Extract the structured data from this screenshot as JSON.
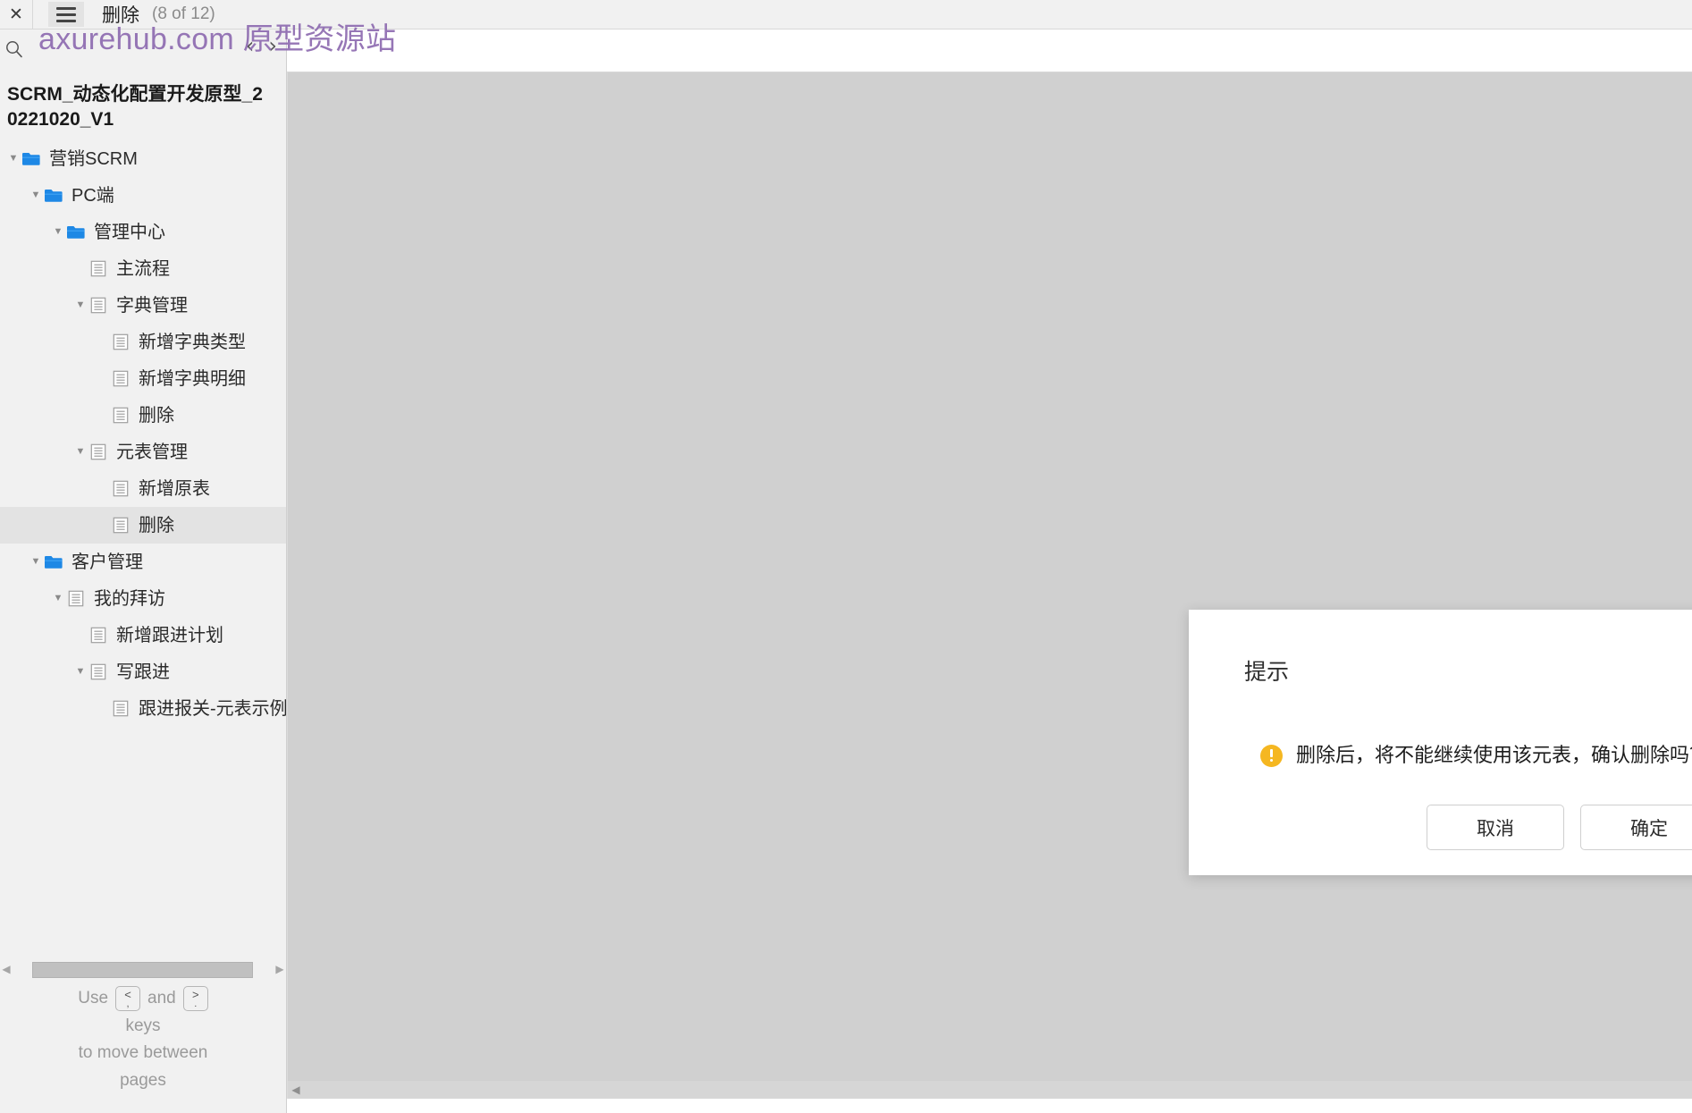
{
  "topbar": {
    "close_icon": "close-icon",
    "menu_icon": "hamburger-menu-icon",
    "page_name": "删除",
    "page_counter": "(8 of 12)"
  },
  "watermark": {
    "text": "axurehub.com 原型资源站",
    "color": "#8e6bb0"
  },
  "sidebar": {
    "search_icon": "search-icon",
    "prev_page_label": "‹",
    "next_page_label": "›",
    "project_title": "SCRM_动态化配置开发原型_20221020_V1",
    "tree": [
      {
        "label": "营销SCRM",
        "depth": 0,
        "icon": "folder-icon",
        "twisty": "▼",
        "selected": false
      },
      {
        "label": "PC端",
        "depth": 1,
        "icon": "folder-icon",
        "twisty": "▼",
        "selected": false
      },
      {
        "label": "管理中心",
        "depth": 2,
        "icon": "folder-icon",
        "twisty": "▼",
        "selected": false
      },
      {
        "label": "主流程",
        "depth": 3,
        "icon": "page-icon",
        "twisty": "",
        "selected": false
      },
      {
        "label": "字典管理",
        "depth": 3,
        "icon": "page-icon",
        "twisty": "▼",
        "selected": false
      },
      {
        "label": "新增字典类型",
        "depth": 4,
        "icon": "page-icon",
        "twisty": "",
        "selected": false
      },
      {
        "label": "新增字典明细",
        "depth": 4,
        "icon": "page-icon",
        "twisty": "",
        "selected": false
      },
      {
        "label": "删除",
        "depth": 4,
        "icon": "page-icon",
        "twisty": "",
        "selected": false
      },
      {
        "label": "元表管理",
        "depth": 3,
        "icon": "page-icon",
        "twisty": "▼",
        "selected": false
      },
      {
        "label": "新增原表",
        "depth": 4,
        "icon": "page-icon",
        "twisty": "",
        "selected": false
      },
      {
        "label": "删除",
        "depth": 4,
        "icon": "page-icon",
        "twisty": "",
        "selected": true
      },
      {
        "label": "客户管理",
        "depth": 1,
        "icon": "folder-icon",
        "twisty": "▼",
        "selected": false
      },
      {
        "label": "我的拜访",
        "depth": 2,
        "icon": "page-icon",
        "twisty": "▼",
        "selected": false
      },
      {
        "label": "新增跟进计划",
        "depth": 3,
        "icon": "page-icon",
        "twisty": "",
        "selected": false
      },
      {
        "label": "写跟进",
        "depth": 3,
        "icon": "page-icon",
        "twisty": "▼",
        "selected": false
      },
      {
        "label": "跟进报关-元表示例",
        "depth": 4,
        "icon": "page-icon",
        "twisty": "",
        "selected": false
      }
    ],
    "hscroll": {
      "left_arrow": "◀",
      "right_arrow": "▶"
    },
    "key_hint": {
      "use": "Use",
      "key_prev_top": "<",
      "key_prev_bottom": ",",
      "and": "and",
      "key_next_top": ">",
      "key_next_bottom": ".",
      "keys_word": "keys",
      "line3": "to move between",
      "line4": "pages"
    }
  },
  "canvas": {
    "background_color": "#d0d0d0",
    "hscroll_left_arrow": "◀"
  },
  "dialog": {
    "title": "提示",
    "warning_icon": "warning-icon",
    "message": "删除后，将不能继续使用该元表，确认删除吗？",
    "cancel_label": "取消",
    "confirm_label": "确定"
  }
}
